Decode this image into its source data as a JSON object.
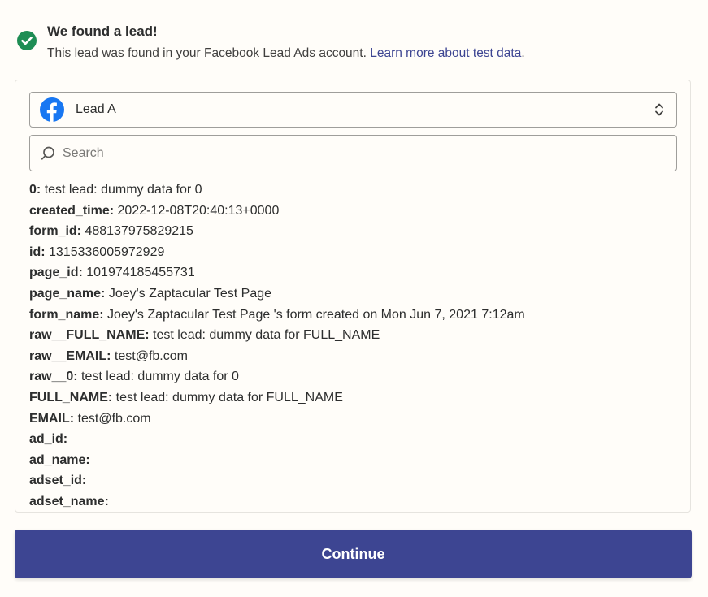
{
  "header": {
    "title": "We found a lead!",
    "subtitle_prefix": "This lead was found in your Facebook Lead Ads account. ",
    "link_text": "Learn more about test data",
    "subtitle_suffix": "."
  },
  "lead_select": {
    "selected": "Lead A",
    "icon": "facebook-icon"
  },
  "search": {
    "placeholder": "Search",
    "value": ""
  },
  "fields": [
    {
      "key": "0:",
      "value": "test lead: dummy data for 0"
    },
    {
      "key": "created_time:",
      "value": "2022-12-08T20:40:13+0000"
    },
    {
      "key": "form_id:",
      "value": "488137975829215"
    },
    {
      "key": "id:",
      "value": "1315336005972929"
    },
    {
      "key": "page_id:",
      "value": "101974185455731"
    },
    {
      "key": "page_name:",
      "value": "Joey's Zaptacular Test Page"
    },
    {
      "key": "form_name:",
      "value": "Joey's Zaptacular Test Page 's form created on Mon Jun 7, 2021 7:12am"
    },
    {
      "key": "raw__FULL_NAME:",
      "value": "test lead: dummy data for FULL_NAME"
    },
    {
      "key": "raw__EMAIL:",
      "value": "test@fb.com"
    },
    {
      "key": "raw__0:",
      "value": "test lead: dummy data for 0"
    },
    {
      "key": "FULL_NAME:",
      "value": "test lead: dummy data for FULL_NAME"
    },
    {
      "key": "EMAIL:",
      "value": "test@fb.com"
    },
    {
      "key": "ad_id:",
      "value": ""
    },
    {
      "key": "ad_name:",
      "value": ""
    },
    {
      "key": "adset_id:",
      "value": ""
    },
    {
      "key": "adset_name:",
      "value": ""
    }
  ],
  "continue_label": "Continue",
  "colors": {
    "success_green": "#1e8d54",
    "facebook_blue": "#1877f2",
    "primary": "#3d4592",
    "background": "#fffdf9"
  }
}
